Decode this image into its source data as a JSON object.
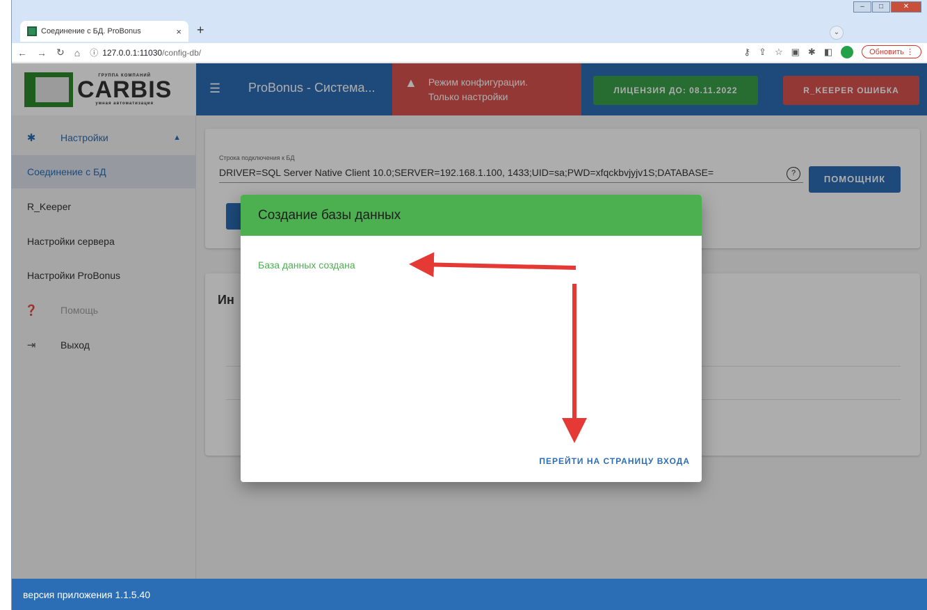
{
  "browser": {
    "tab_title": "Соединение с БД. ProBonus",
    "tab_close": "×",
    "new_tab": "+",
    "url_host": "127.0.0.1:11030",
    "url_path": "/config-db/",
    "update_label": "Обновить"
  },
  "header": {
    "logo_small": "ГРУППА КОМПАНИЙ",
    "logo_big": "CARBIS",
    "logo_sub": "умная автоматизация",
    "app_title": "ProBonus - Система...",
    "config_line1": "Режим конфигурации.",
    "config_line2": "Только настройки",
    "license_label": "ЛИЦЕНЗИЯ ДО: 08.11.2022",
    "rkeeper_label": "R_KEEPER ОШИБКА"
  },
  "sidebar": {
    "items": [
      {
        "label": "Настройки"
      },
      {
        "label": "Соединение с БД"
      },
      {
        "label": "R_Keeper"
      },
      {
        "label": "Настройки сервера"
      },
      {
        "label": "Настройки ProBonus"
      },
      {
        "label": "Помощь"
      },
      {
        "label": "Выход"
      }
    ]
  },
  "main": {
    "conn_label": "Строка подключения к БД",
    "conn_value": "DRIVER=SQL Server Native Client 10.0;SERVER=192.168.1.100, 1433;UID=sa;PWD=xfqckbvjyjv1S;DATABASE=",
    "helper_label": "ПОМОЩНИК",
    "info_title": "Ин"
  },
  "dialog": {
    "title": "Создание базы данных",
    "status": "База данных создана",
    "action": "ПЕРЕЙТИ НА СТРАНИЦУ ВХОДА"
  },
  "footer": {
    "version": "версия приложения 1.1.5.40"
  },
  "colors": {
    "primary": "#2c6eb5",
    "success": "#4caf50",
    "danger": "#d9534f",
    "license": "#3aa047",
    "annotation_arrow": "#e53935"
  }
}
